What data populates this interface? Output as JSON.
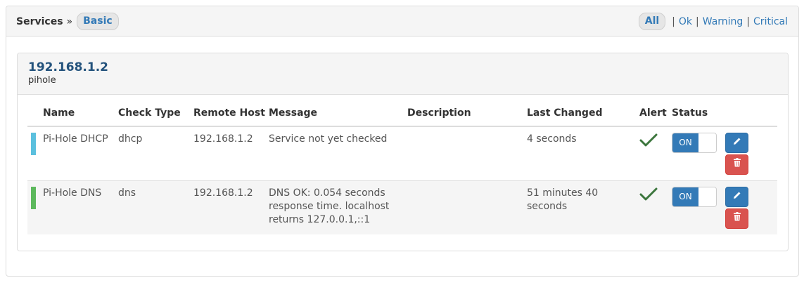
{
  "header": {
    "title": "Services",
    "separator": "»",
    "view_pill": "Basic",
    "filters": {
      "active": "All",
      "ok": "Ok",
      "warning": "Warning",
      "critical": "Critical",
      "sep": "|"
    }
  },
  "host": {
    "ip": "192.168.1.2",
    "name": "pihole"
  },
  "table": {
    "columns": [
      "Name",
      "Check Type",
      "Remote Host",
      "Message",
      "Description",
      "Last Changed",
      "Alert",
      "Status"
    ],
    "rows": [
      {
        "status_color": "#5bc0de",
        "name": "Pi-Hole DHCP",
        "check_type": "dhcp",
        "remote_host": "192.168.1.2",
        "message": "Service not yet checked",
        "description": "",
        "last_changed": "4 seconds",
        "alert_icon": "check-icon",
        "toggle": "ON"
      },
      {
        "status_color": "#5cb85c",
        "name": "Pi-Hole DNS",
        "check_type": "dns",
        "remote_host": "192.168.1.2",
        "message": "DNS OK: 0.054 seconds response time. localhost returns 127.0.0.1,::1",
        "description": "",
        "last_changed": "51 minutes 40 seconds",
        "alert_icon": "check-icon",
        "toggle": "ON"
      }
    ]
  },
  "colors": {
    "primary": "#337ab7",
    "danger": "#d9534f",
    "success": "#3c763d"
  }
}
